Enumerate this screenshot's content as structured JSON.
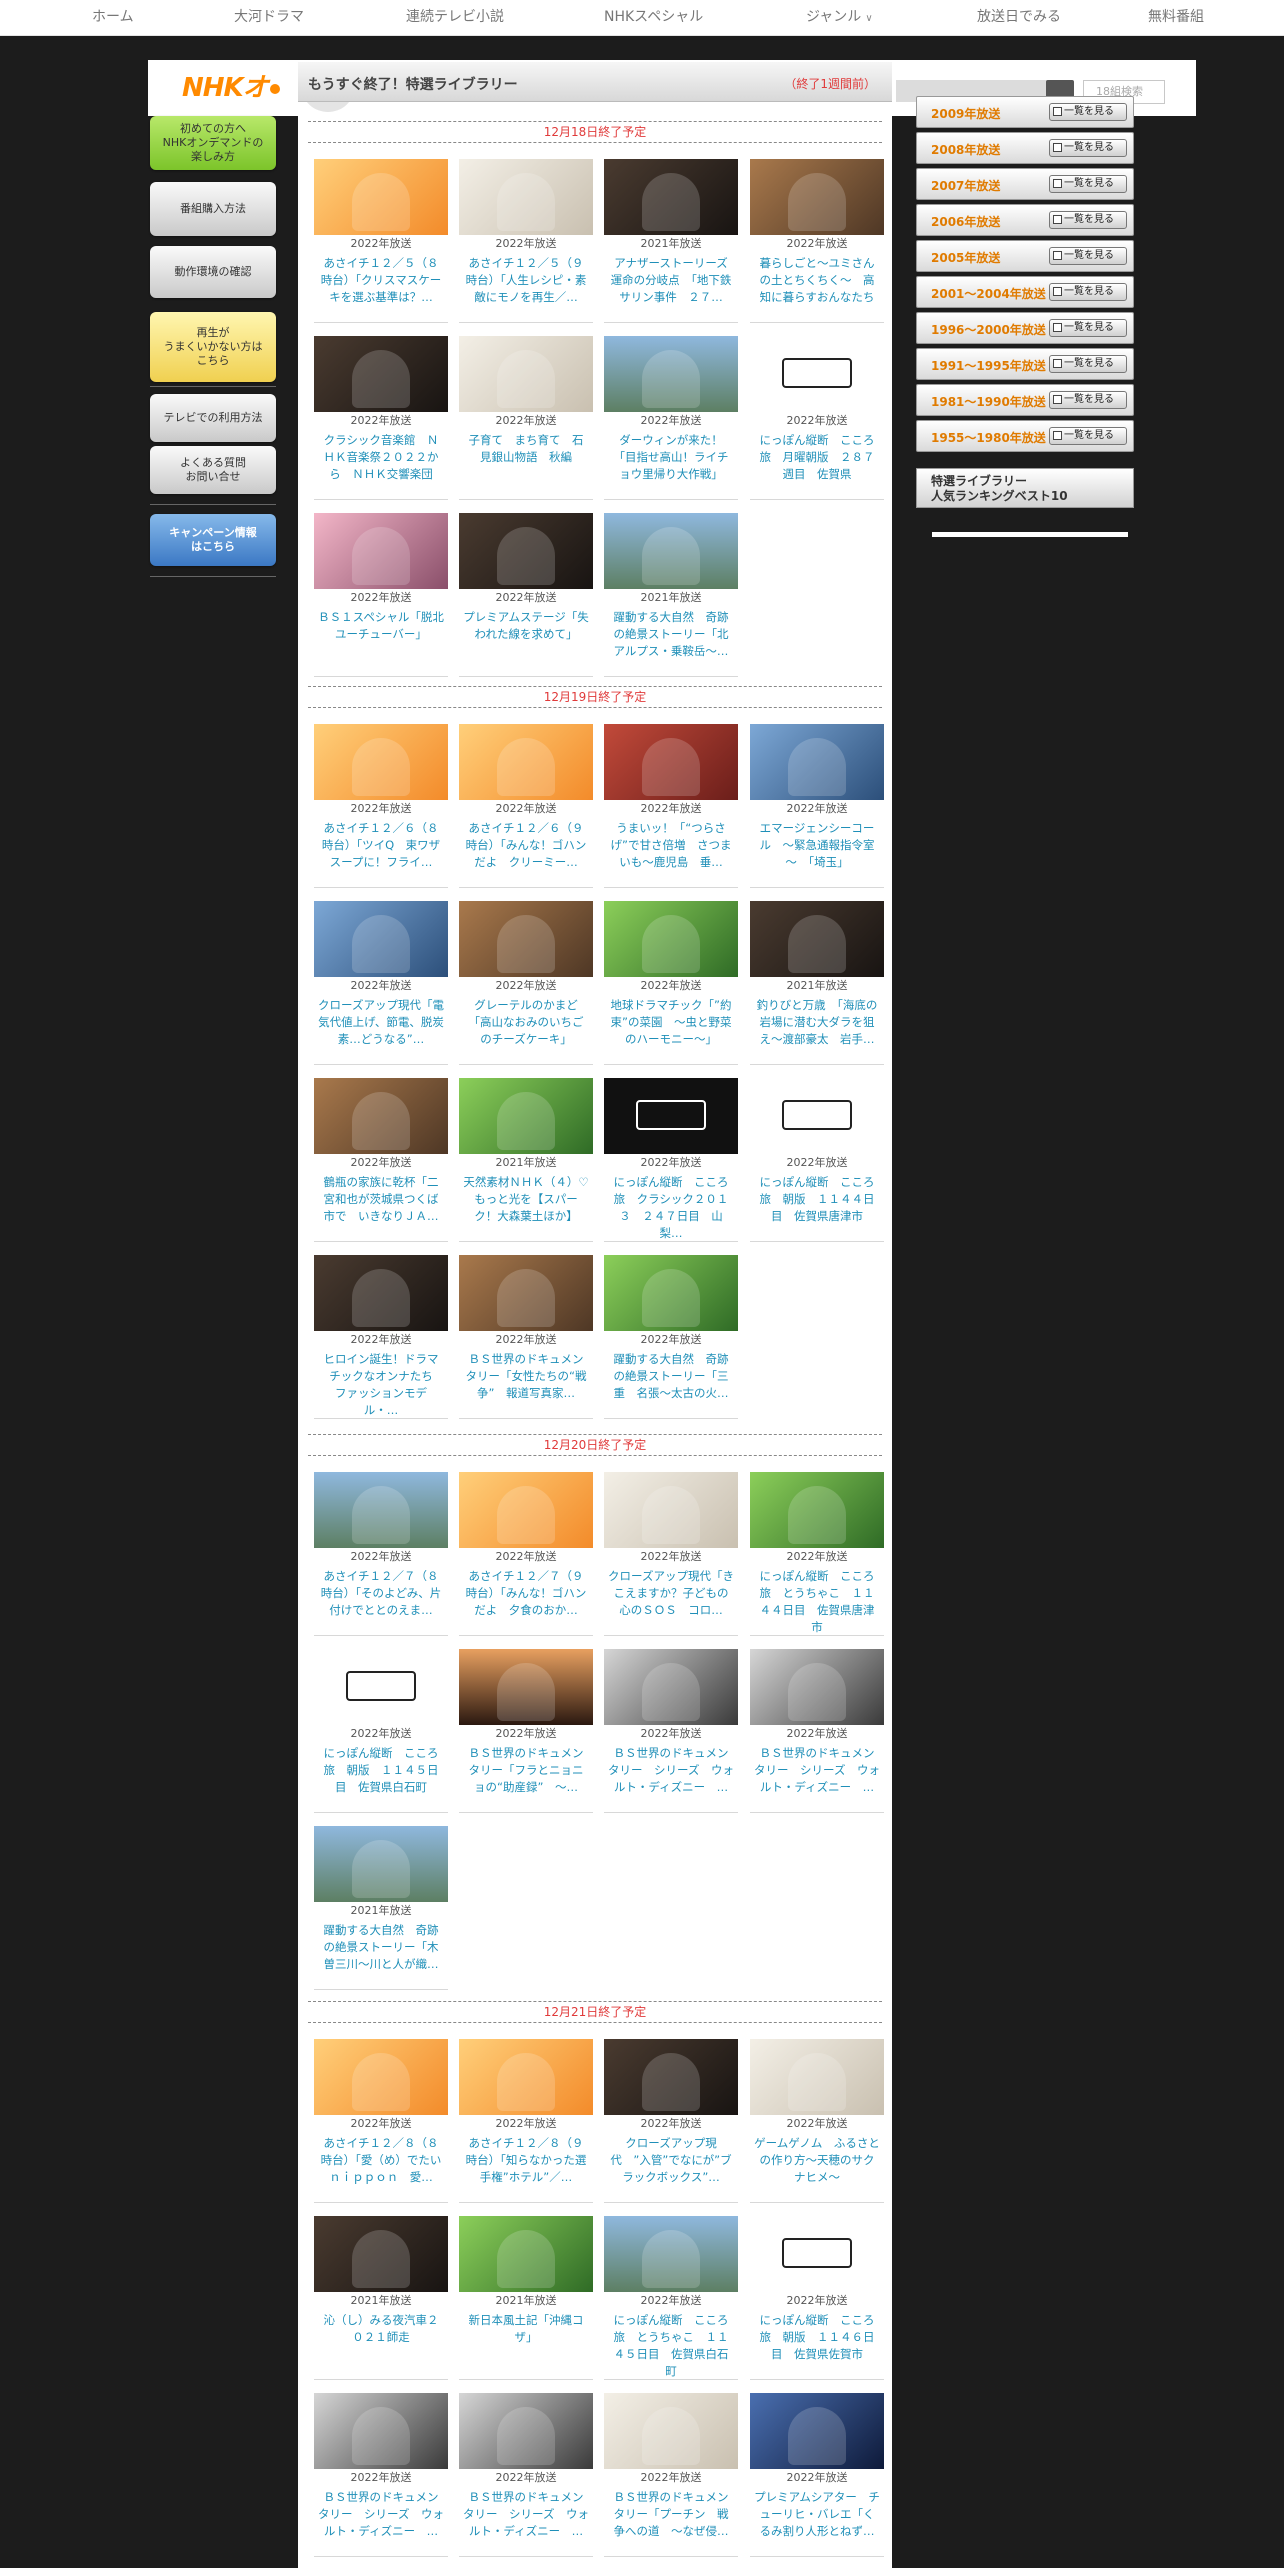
{
  "nav": [
    "ホーム",
    "大河ドラマ",
    "連続テレビ小説",
    "NHKスペシャル",
    "ジャンル",
    "放送日でみる",
    "無料番組"
  ],
  "header": {
    "logo": "NHKオ",
    "search_placeholder": "18組検索"
  },
  "sidebar": {
    "buttons": [
      {
        "label": "初めての方へ\nNHKオンデマンドの\n楽しみ方",
        "style": "green"
      },
      {
        "label": "番組購入方法",
        "style": "gray"
      },
      {
        "label": "動作環境の確認",
        "style": "gray"
      },
      {
        "label": "再生が\nうまくいかない方は\nこちら",
        "style": "yellow"
      },
      {
        "label": "テレビでの利用方法",
        "style": "gray"
      },
      {
        "label": "よくある質問\nお問い合せ",
        "style": "gray"
      },
      {
        "label": "キャンペーン情報\nはこちら",
        "style": "blue"
      }
    ]
  },
  "main": {
    "title": "もうすぐ終了！特選ライブラリー",
    "subtitle": "（終了1週間前）",
    "sections": [
      {
        "heading": "12月18日終了予定",
        "items": [
          {
            "year": "2022年放送",
            "title": "あさイチ１２／５（８時台）「クリスマスケーキを選ぶ基準は？…",
            "thumb": "orange"
          },
          {
            "year": "2022年放送",
            "title": "あさイチ１２／５（９時台）「人生レシピ・素敵にモノを再生／…",
            "thumb": "light"
          },
          {
            "year": "2021年放送",
            "title": "アナザーストーリーズ　運命の分岐点　「地下鉄サリン事件　２７…",
            "thumb": "dark"
          },
          {
            "year": "2022年放送",
            "title": "暮らしごと～ユミさんの土とちくちく～　高知に暮らすおんなたち",
            "thumb": "brown"
          },
          {
            "year": "2022年放送",
            "title": "クラシック音楽館　ＮＨＫ音楽祭２０２２から　ＮＨＫ交響楽団",
            "thumb": "dark"
          },
          {
            "year": "2022年放送",
            "title": "子育て　まち育て　石見銀山物語　秋編",
            "thumb": "light"
          },
          {
            "year": "2022年放送",
            "title": "ダーウィンが来た！「目指せ高山！ライチョウ里帰り大作戦」",
            "thumb": "sky"
          },
          {
            "year": "2022年放送",
            "title": "にっぽん縦断　こころ旅　月曜朝版　２８７週目　佐賀県",
            "thumb": "kokoro"
          },
          {
            "year": "2022年放送",
            "title": "ＢＳ１スペシャル「脱北ユーチューバー」",
            "thumb": "pink"
          },
          {
            "year": "2022年放送",
            "title": "プレミアムステージ「失われた線を求めて」",
            "thumb": "dark"
          },
          {
            "year": "2021年放送",
            "title": "躍動する大自然　奇跡の絶景ストーリー「北アルプス・乗鞍岳～…",
            "thumb": "sky"
          }
        ]
      },
      {
        "heading": "12月19日終了予定",
        "items": [
          {
            "year": "2022年放送",
            "title": "あさイチ１２／６（８時台）「ツイQ　束ワザスープに！フライ…",
            "thumb": "orange"
          },
          {
            "year": "2022年放送",
            "title": "あさイチ１２／６（９時台）「みんな！ゴハンだよ　クリーミー…",
            "thumb": "orange"
          },
          {
            "year": "2022年放送",
            "title": "うまいッ！「“つらさげ”で甘さ倍増　さつまいも～鹿児島　垂…",
            "thumb": "red"
          },
          {
            "year": "2022年放送",
            "title": "エマージェンシーコール　～緊急通報指令室～　「埼玉」",
            "thumb": "blue"
          },
          {
            "year": "2022年放送",
            "title": "クローズアップ現代「電気代値上げ、節電、脱炭素…どうなる”…",
            "thumb": "blue"
          },
          {
            "year": "2022年放送",
            "title": "グレーテルのかまど「高山なおみのいちごのチーズケーキ」",
            "thumb": "brown"
          },
          {
            "year": "2022年放送",
            "title": "地球ドラマチック「”約束”の菜園　～虫と野菜のハーモニー～」",
            "thumb": "green"
          },
          {
            "year": "2021年放送",
            "title": "釣りびと万歳　「海底の岩場に潜む大ダラを狙え～渡部豪太　岩手…",
            "thumb": "dark"
          },
          {
            "year": "2022年放送",
            "title": "鶴瓶の家族に乾杯「二宮和也が茨城県つくば市で　いきなりＪＡ…",
            "thumb": "brown"
          },
          {
            "year": "2021年放送",
            "title": "天然素材ＮＨＫ（４）♡もっと光を【スパーク！大森葉土ほか】",
            "thumb": "green"
          },
          {
            "year": "2022年放送",
            "title": "にっぽん縦断　こころ旅　クラシック２０１３　２４７日目　山梨…",
            "thumb": "classic"
          },
          {
            "year": "2022年放送",
            "title": "にっぽん縦断　こころ旅　朝版　１１４４日目　佐賀県唐津市",
            "thumb": "kokoro"
          },
          {
            "year": "2022年放送",
            "title": "ヒロイン誕生！ドラマチックなオンナたち　ファッションモデル・…",
            "thumb": "dark"
          },
          {
            "year": "2022年放送",
            "title": "ＢＳ世界のドキュメンタリー「女性たちの“戦争”　報道写真家…",
            "thumb": "brown"
          },
          {
            "year": "2022年放送",
            "title": "躍動する大自然　奇跡の絶景ストーリー「三重　名張～太古の火…",
            "thumb": "green"
          }
        ]
      },
      {
        "heading": "12月20日終了予定",
        "items": [
          {
            "year": "2022年放送",
            "title": "あさイチ１２／７（８時台）「そのよどみ、片付けでととのえま…",
            "thumb": "sky"
          },
          {
            "year": "2022年放送",
            "title": "あさイチ１２／７（９時台）「みんな！ゴハンだよ　夕食のおか…",
            "thumb": "orange"
          },
          {
            "year": "2022年放送",
            "title": "クローズアップ現代「きこえますか？子どもの心のＳＯＳ　コロ…",
            "thumb": "light"
          },
          {
            "year": "2022年放送",
            "title": "にっぽん縦断　こころ旅　とうちゃこ　１１４４日目　佐賀県唐津市",
            "thumb": "green"
          },
          {
            "year": "2022年放送",
            "title": "にっぽん縦断　こころ旅　朝版　１１４５日目　佐賀県白石町",
            "thumb": "kokoro"
          },
          {
            "year": "2022年放送",
            "title": "ＢＳ世界のドキュメンタリー「フラとニョニョの“助産録”　～…",
            "thumb": "dusk"
          },
          {
            "year": "2022年放送",
            "title": "ＢＳ世界のドキュメンタリー　シリーズ　ウォルト・ディズニー　…",
            "thumb": "bw"
          },
          {
            "year": "2022年放送",
            "title": "ＢＳ世界のドキュメンタリー　シリーズ　ウォルト・ディズニー　…",
            "thumb": "bw"
          },
          {
            "year": "2021年放送",
            "title": "躍動する大自然　奇跡の絶景ストーリー「木曽三川～川と人が織…",
            "thumb": "sky"
          }
        ]
      },
      {
        "heading": "12月21日終了予定",
        "items": [
          {
            "year": "2022年放送",
            "title": "あさイチ１２／８（８時台）「愛（め）でたいｎｉｐｐｏｎ　愛…",
            "thumb": "orange"
          },
          {
            "year": "2022年放送",
            "title": "あさイチ１２／８（９時台）「知らなかった選手権”ホテル”／…",
            "thumb": "orange"
          },
          {
            "year": "2022年放送",
            "title": "クローズアップ現代　”入管”でなにが”ブラックボックス”…",
            "thumb": "dark"
          },
          {
            "year": "2022年放送",
            "title": "ゲームゲノム　ふるさとの作り方～天穂のサクナヒメ～",
            "thumb": "light"
          },
          {
            "year": "2021年放送",
            "title": "沁（し）みる夜汽車２０２１師走",
            "thumb": "dark"
          },
          {
            "year": "2021年放送",
            "title": "新日本風土記「沖縄コザ」",
            "thumb": "green"
          },
          {
            "year": "2022年放送",
            "title": "にっぽん縦断　こころ旅　とうちゃこ　１１４５日目　佐賀県白石町",
            "thumb": "sky"
          },
          {
            "year": "2022年放送",
            "title": "にっぽん縦断　こころ旅　朝版　１１４６日目　佐賀県佐賀市",
            "thumb": "kokoro"
          },
          {
            "year": "2022年放送",
            "title": "ＢＳ世界のドキュメンタリー　シリーズ　ウォルト・ディズニー　…",
            "thumb": "bw"
          },
          {
            "year": "2022年放送",
            "title": "ＢＳ世界のドキュメンタリー　シリーズ　ウォルト・ディズニー　…",
            "thumb": "bw"
          },
          {
            "year": "2022年放送",
            "title": "ＢＳ世界のドキュメンタリー「プーチン　戦争への道　～なぜ侵…",
            "thumb": "light"
          },
          {
            "year": "2022年放送",
            "title": "プレミアムシアター　チューリヒ・バレエ「くるみ割り人形とねず…",
            "thumb": "stage"
          }
        ]
      }
    ]
  },
  "right": {
    "years": [
      "2009年放送",
      "2008年放送",
      "2007年放送",
      "2006年放送",
      "2005年放送",
      "2001～2004年放送",
      "1996～2000年放送",
      "1991～1995年放送",
      "1981～1990年放送",
      "1955～1980年放送"
    ],
    "view_all_label": "一覧を見る",
    "ranking_label": "特選ライブラリー\n人気ランキングベスト10"
  },
  "colors": {
    "accent_red": "#e03a3a",
    "link_blue": "#1f8fb8",
    "orange": "#e07b00",
    "logo_orange": "#ff8a00"
  }
}
